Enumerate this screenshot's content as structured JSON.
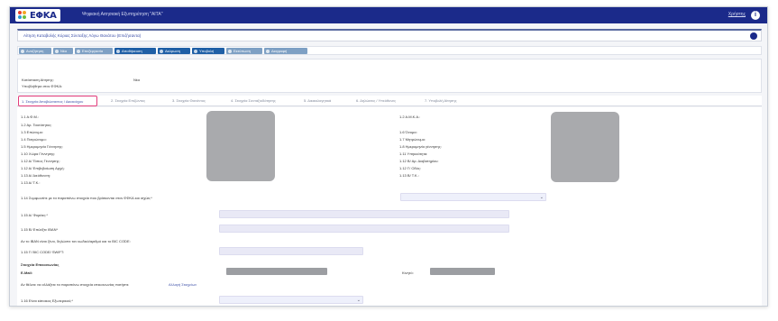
{
  "app": {
    "logo_text": "ΕΦΚΑ",
    "title": "Ψηφιακή Αιτησιακή Εξυπηρέτηση \"ΑΙΤΑ\"",
    "user_link": "Χρήστης",
    "info_icon": "info-icon"
  },
  "breadcrumb": "Αίτηση Καταβολής Κύριας Σύνταξης Λόγω Θανάτου (Επιζήσαντα)",
  "toolbar": [
    {
      "label": "Αναζήτηση",
      "icon": "search-icon",
      "color": "#7ea0c4"
    },
    {
      "label": "Νέα",
      "icon": "plus-icon",
      "color": "#7ea0c4"
    },
    {
      "label": "Επεξεργασία",
      "icon": "pencil-icon",
      "color": "#7ea0c4"
    },
    {
      "label": "Αποθήκευση",
      "icon": "save-icon",
      "color": "#1f5fa6"
    },
    {
      "label": "Ακύρωση",
      "icon": "cancel-icon",
      "color": "#1f5fa6"
    },
    {
      "label": "Υποβολή",
      "icon": "check-icon",
      "color": "#1f5fa6"
    },
    {
      "label": "Εκτύπωση",
      "icon": "print-icon",
      "color": "#7ea0c4"
    },
    {
      "label": "Διαγραφή",
      "icon": "trash-icon",
      "color": "#7ea0c4"
    }
  ],
  "info": {
    "status_label": "Κατάσταση Αίτησης:",
    "status_value": "Νέα",
    "sub_label": "Υποβλήθηκε στον ΕΦΚΑ:"
  },
  "tabs": [
    "1. Στοιχεία Αποβιώσαντος / Δικαιούχου",
    "2. Στοιχεία Επιζώντος",
    "3. Στοιχεία Θανόντος",
    "4. Στοιχεία Συνταξιοδότησης",
    "5. Δικαιολογητικά",
    "6. Δηλώσεις / Υπεύθυνες",
    "7. Υποβολή Αίτησης"
  ],
  "left_fields": [
    "1.1 Α.Φ.Μ.:",
    "1.2 Αρ. Ταυτότητας:",
    "1.3 Επώνυμο:",
    "1.4 Πατρώνυμο:",
    "1.5 Ημερομηνία Γέννησης:",
    "1.10 Χώρα Γέννησης:",
    "1.12 Α/ Τόπος Γέννησης:",
    "1.12 Α/ Επιβεβαίωση Αρχή:",
    "1.13 Α/ Διεύθυνση:",
    "1.13 Α/ Τ.Κ.:"
  ],
  "right_fields": [
    "1.2 Α.Μ.Κ.Α.:",
    "1.6 Όνομα:",
    "1.7 Μητρώνυμο:",
    "1.8 Ημερομηνία γέννησης:",
    "1.11 Υπηκοότητα:",
    "1.12 Β/ Αρ. Διαβατηρίου:",
    "1.12 Γ/ Οδός:",
    "1.13 Β/ Τ.Κ.:"
  ],
  "form": {
    "q_label": "1.14 Συμφωνείτε με τα παραπάνω στοιχεία που βρίσκονται στον ΕΦΚΑ και ισχύει;*",
    "bank_label": "1.15 Α/ Φορέας:*",
    "iban_label": "1.15 Β/ Επιλέξτε IBAN*",
    "iban_note": "Αν το IBAN είναι ξένο, δηλώστε τον κωδικό/αριθμό και το BIC CODE:",
    "bic_label": "1.15 Γ/ BIC CODE/ SWIFT:",
    "contact_heading": "Στοιχεία Επικοινωνίας",
    "email_label": "E-Mail:",
    "phone_label": "Κινητό:",
    "contact_note": "Αν θέλετε να αλλάξετε τα παραπάνω στοιχεία επικοινωνίας πατήστε",
    "contact_link": "Αλλαγή Στοιχείων",
    "last_label": "1.16 Είναι κάτοικος Εξωτερικού;*"
  }
}
